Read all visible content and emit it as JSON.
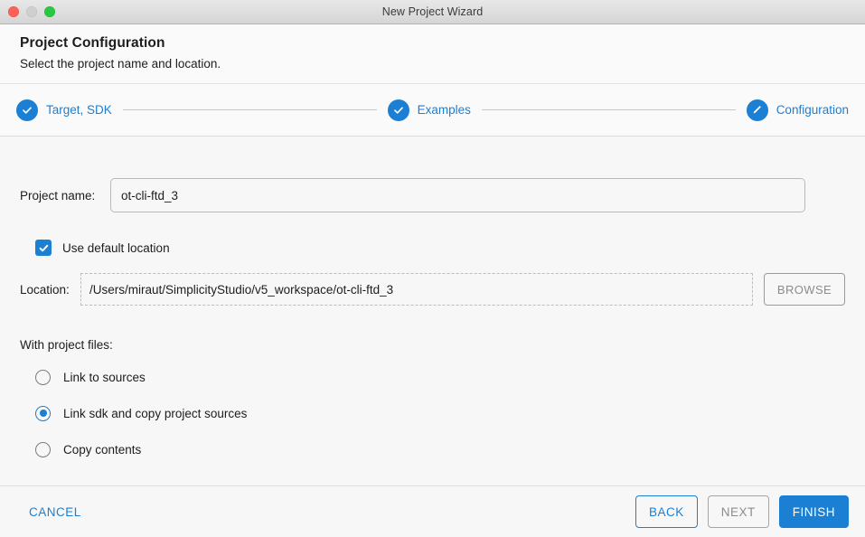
{
  "window": {
    "title": "New Project Wizard",
    "controls": {
      "close": "close-button",
      "minimize": "minimize-button",
      "maximize": "maximize-button"
    }
  },
  "header": {
    "title": "Project Configuration",
    "subtitle": "Select the project name and location."
  },
  "stepper": {
    "steps": [
      {
        "label": "Target, SDK",
        "state": "completed",
        "icon": "check-icon"
      },
      {
        "label": "Examples",
        "state": "completed",
        "icon": "check-icon"
      },
      {
        "label": "Configuration",
        "state": "current",
        "icon": "pencil-icon"
      }
    ]
  },
  "form": {
    "project_name": {
      "label": "Project name:",
      "value": "ot-cli-ftd_3",
      "placeholder": "Project name"
    },
    "use_default_location": {
      "label": "Use default location",
      "checked": true
    },
    "location": {
      "label": "Location:",
      "value": "/Users/miraut/SimplicityStudio/v5_workspace/ot-cli-ftd_3",
      "placeholder": "Location",
      "disabled": true
    },
    "browse_button": {
      "label": "BROWSE",
      "disabled": true
    },
    "project_files": {
      "label": "With project files:",
      "options": [
        {
          "label": "Link to sources",
          "selected": false
        },
        {
          "label": "Link sdk and copy project sources",
          "selected": true
        },
        {
          "label": "Copy contents",
          "selected": false
        }
      ]
    }
  },
  "footer": {
    "cancel": "CANCEL",
    "back": "BACK",
    "next": "NEXT",
    "finish": "FINISH"
  },
  "colors": {
    "accent": "#1b7fd4",
    "dialog_bg": "#f7f7f7",
    "header_bg": "#fafafa",
    "disabled_text": "#8c8c8c"
  }
}
